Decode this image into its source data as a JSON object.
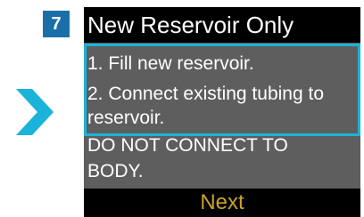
{
  "step": {
    "number": "7",
    "color": "#1b6fa8"
  },
  "indicator": {
    "icon": "chevron-right-icon",
    "color": "#1ab3d9"
  },
  "screen": {
    "title": "New Reservoir Only",
    "instructions": [
      "1. Fill new reservoir.",
      "2. Connect existing tubing to",
      "reservoir."
    ],
    "warning_lines": [
      "DO NOT CONNECT TO",
      "BODY."
    ],
    "highlight_color": "#1ab3d9",
    "next_label": "Next",
    "next_color": "#c9a227"
  }
}
